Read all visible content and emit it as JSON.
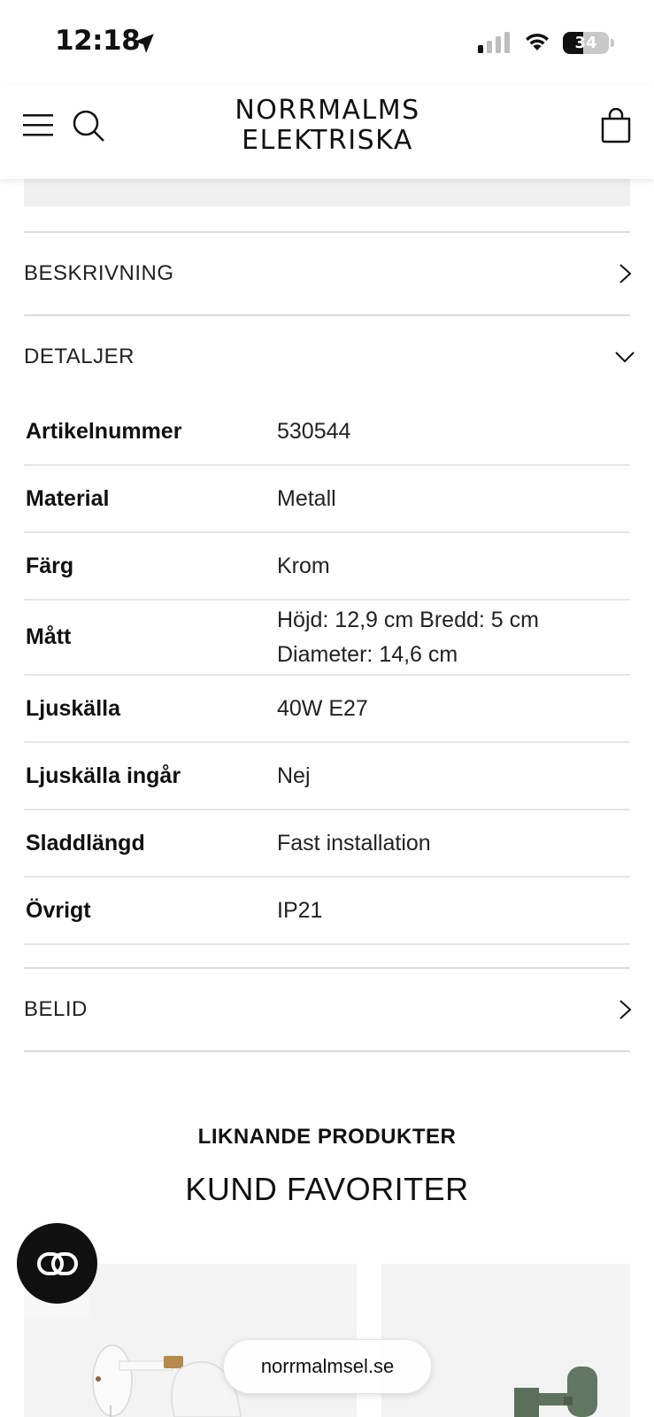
{
  "status_bar": {
    "time": "12:18",
    "battery": "34"
  },
  "header": {
    "logo_line1": "NORRMALMS",
    "logo_line2": "ELEKTRISKA"
  },
  "accordion": {
    "description_label": "BESKRIVNING",
    "details_label": "DETALJER",
    "brand_label": "BELID"
  },
  "details": [
    {
      "key": "Artikelnummer",
      "value": "530544"
    },
    {
      "key": "Material",
      "value": "Metall"
    },
    {
      "key": "Färg",
      "value": "Krom"
    },
    {
      "key": "Mått",
      "value": "Höjd: 12,9 cm Bredd: 5 cm Diameter: 14,6 cm"
    },
    {
      "key": "Ljuskälla",
      "value": "40W E27"
    },
    {
      "key": "Ljuskälla ingår",
      "value": "Nej"
    },
    {
      "key": "Sladdlängd",
      "value": "Fast installation"
    },
    {
      "key": "Övrigt",
      "value": "IP21"
    }
  ],
  "similar": {
    "kicker": "LIKNANDE PRODUKTER",
    "title": "KUND FAVORITER"
  },
  "browser": {
    "url": "norrmalmsel.se"
  },
  "colors": {
    "divider": "#dcdcdc",
    "card_bg": "#f3f3f3",
    "chat_bg": "#111111"
  }
}
